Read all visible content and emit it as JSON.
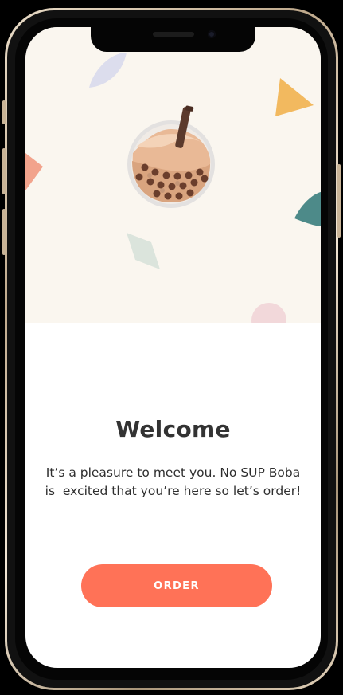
{
  "colors": {
    "accent": "#ff7257",
    "hero_bg": "#faf6ef",
    "title": "#333333"
  },
  "illustration": {
    "icon": "boba-tea-cup-icon"
  },
  "welcome": {
    "title": "Welcome",
    "message_line1": "It’s a pleasure to meet you. No SUP Boba",
    "message_line2": "is  excited that you’re here so let’s order!"
  },
  "actions": {
    "order_label": "ORDER"
  }
}
